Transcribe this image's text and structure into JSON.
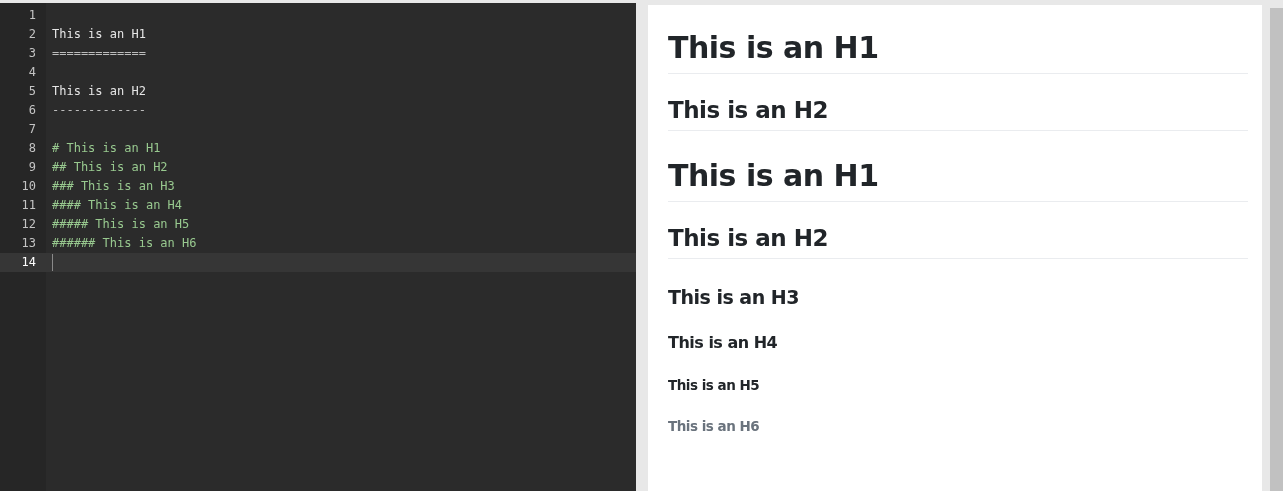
{
  "editor": {
    "lines": [
      {
        "number": "1",
        "selected": false
      },
      {
        "number": "2",
        "text": "This is an H1",
        "kind": "plain",
        "selected": false
      },
      {
        "number": "3",
        "text": "=============",
        "kind": "rule",
        "selected": false
      },
      {
        "number": "4",
        "selected": false
      },
      {
        "number": "5",
        "text": "This is an H2",
        "kind": "plain",
        "selected": false
      },
      {
        "number": "6",
        "text": "-------------",
        "kind": "rule",
        "selected": false
      },
      {
        "number": "7",
        "selected": false
      },
      {
        "number": "8",
        "text": "# This is an H1",
        "kind": "heading",
        "selected": false
      },
      {
        "number": "9",
        "text": "## This is an H2",
        "kind": "heading",
        "selected": false
      },
      {
        "number": "10",
        "text": "### This is an H3",
        "kind": "heading",
        "selected": false
      },
      {
        "number": "11",
        "text": "#### This is an H4",
        "kind": "heading",
        "selected": false
      },
      {
        "number": "12",
        "text": "##### This is an H5",
        "kind": "heading",
        "selected": false
      },
      {
        "number": "13",
        "text": "###### This is an H6",
        "kind": "heading",
        "selected": false
      },
      {
        "number": "14",
        "selected": true
      }
    ]
  },
  "preview": {
    "headings": [
      {
        "kind": "h1",
        "text": "This is an H1"
      },
      {
        "kind": "h2",
        "text": "This is an H2"
      },
      {
        "kind": "h1",
        "text": "This is an H1"
      },
      {
        "kind": "h2",
        "text": "This is an H2"
      },
      {
        "kind": "h3",
        "text": "This is an H3"
      },
      {
        "kind": "h4",
        "text": "This is an H4"
      },
      {
        "kind": "h5",
        "text": "This is an H5"
      },
      {
        "kind": "h6",
        "text": "This is an H6"
      }
    ]
  }
}
